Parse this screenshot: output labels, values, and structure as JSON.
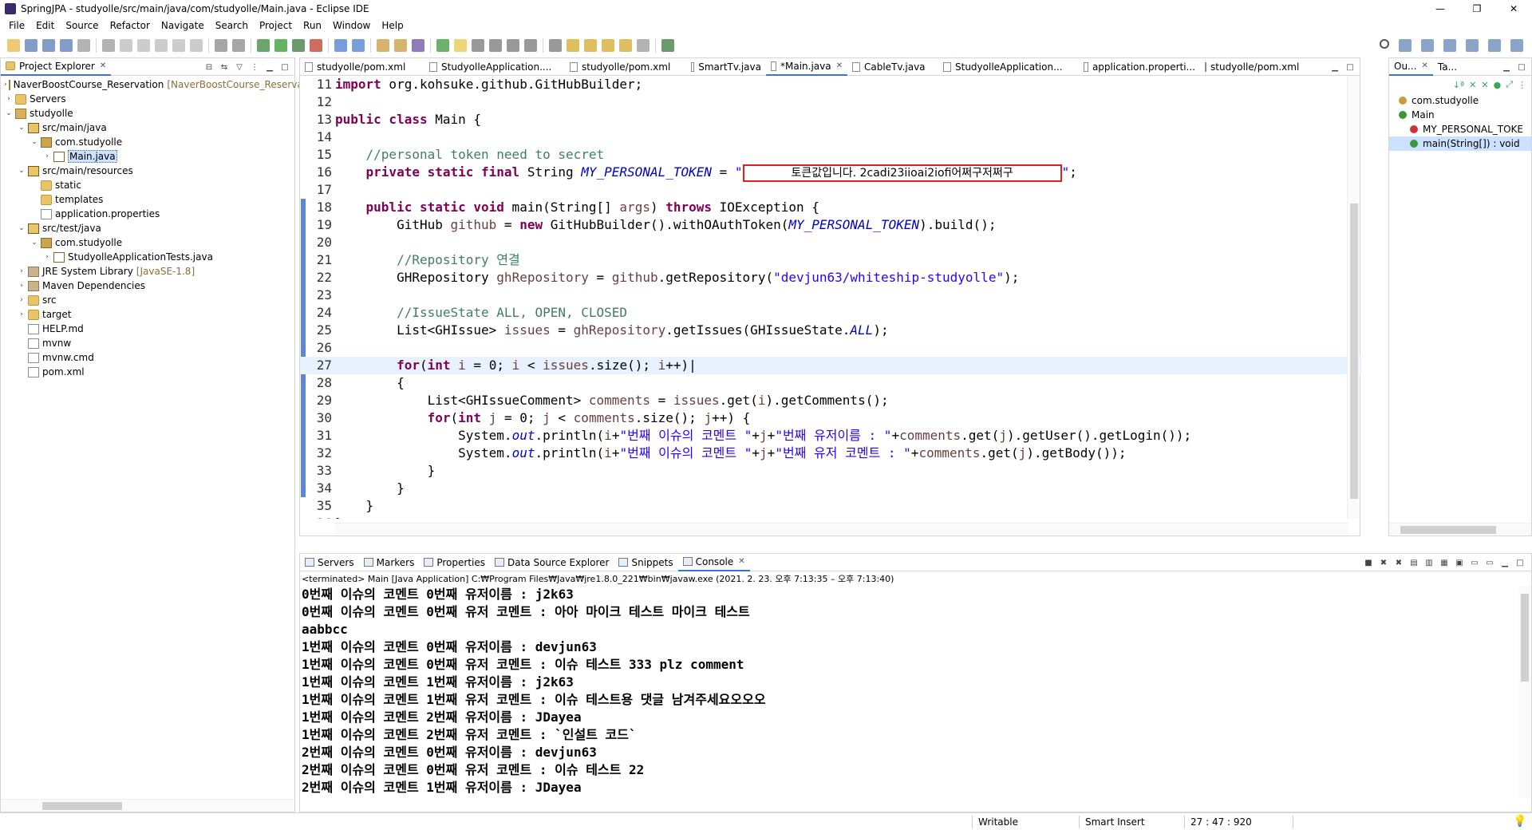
{
  "window": {
    "title": "SpringJPA - studyolle/src/main/java/com/studyolle/Main.java - Eclipse IDE"
  },
  "menu": [
    "File",
    "Edit",
    "Source",
    "Refactor",
    "Navigate",
    "Search",
    "Project",
    "Run",
    "Window",
    "Help"
  ],
  "explorer": {
    "title": "Project Explorer",
    "items": [
      {
        "label": "NaverBoostCourse_Reservation",
        "deco": "[NaverBoostCourse_Reserva",
        "depth": 0,
        "tw": ">",
        "icon": "proj"
      },
      {
        "label": "Servers",
        "depth": 0,
        "tw": ">",
        "icon": "folder"
      },
      {
        "label": "studyolle",
        "depth": 0,
        "tw": "v",
        "icon": "proj"
      },
      {
        "label": "src/main/java",
        "depth": 1,
        "tw": "v",
        "icon": "src"
      },
      {
        "label": "com.studyolle",
        "depth": 2,
        "tw": "v",
        "icon": "pkg"
      },
      {
        "label": "Main.java",
        "depth": 3,
        "tw": ">",
        "icon": "java",
        "selected": true
      },
      {
        "label": "src/main/resources",
        "depth": 1,
        "tw": "v",
        "icon": "src"
      },
      {
        "label": "static",
        "depth": 2,
        "tw": "",
        "icon": "folder"
      },
      {
        "label": "templates",
        "depth": 2,
        "tw": "",
        "icon": "folder"
      },
      {
        "label": "application.properties",
        "depth": 2,
        "tw": "",
        "icon": "file"
      },
      {
        "label": "src/test/java",
        "depth": 1,
        "tw": "v",
        "icon": "src"
      },
      {
        "label": "com.studyolle",
        "depth": 2,
        "tw": "v",
        "icon": "pkg"
      },
      {
        "label": "StudyolleApplicationTests.java",
        "depth": 3,
        "tw": ">",
        "icon": "java"
      },
      {
        "label": "JRE System Library",
        "deco": "[JavaSE-1.8]",
        "depth": 1,
        "tw": ">",
        "icon": "lib"
      },
      {
        "label": "Maven Dependencies",
        "depth": 1,
        "tw": ">",
        "icon": "lib"
      },
      {
        "label": "src",
        "depth": 1,
        "tw": ">",
        "icon": "folder"
      },
      {
        "label": "target",
        "depth": 1,
        "tw": ">",
        "icon": "folder"
      },
      {
        "label": "HELP.md",
        "depth": 1,
        "tw": "",
        "icon": "file"
      },
      {
        "label": "mvnw",
        "depth": 1,
        "tw": "",
        "icon": "file"
      },
      {
        "label": "mvnw.cmd",
        "depth": 1,
        "tw": "",
        "icon": "file"
      },
      {
        "label": "pom.xml",
        "depth": 1,
        "tw": "",
        "icon": "file"
      }
    ]
  },
  "editor": {
    "tabs": [
      {
        "label": "studyolle/pom.xml"
      },
      {
        "label": "StudyolleApplication...."
      },
      {
        "label": "studyolle/pom.xml"
      },
      {
        "label": "SmartTv.java"
      },
      {
        "label": "*Main.java",
        "active": true
      },
      {
        "label": "CableTv.java"
      },
      {
        "label": "StudyolleApplication..."
      },
      {
        "label": "application.properti..."
      },
      {
        "label": "studyolle/pom.xml"
      }
    ],
    "token_text": "토큰값입니다. 2cadi23iioai2iofi어쩌구저쩌구",
    "lines": [
      {
        "n": "11",
        "html": "<span class=\"kw\">import</span> org.kohsuke.github.GitHubBuilder;"
      },
      {
        "n": "12",
        "html": ""
      },
      {
        "n": "13",
        "html": "<span class=\"kw\">public class</span> Main {"
      },
      {
        "n": "14",
        "html": ""
      },
      {
        "n": "15",
        "html": "    <span class=\"cm\">//personal token need to secret</span>"
      },
      {
        "n": "16",
        "html": "    <span class=\"kw\">private static final</span> String <span class=\"fd\">MY_PERSONAL_TOKEN</span> = <span class=\"st\">\"</span><span id=\"tokenbox\" data-name=\"token-redaction-box\" data-interactable=\"false\" data-bind=\"editor.token_text\"></span><span class=\"st\">\"</span>;"
      },
      {
        "n": "17",
        "html": ""
      },
      {
        "n": "18",
        "html": "    <span class=\"kw\">public static void</span> main(String[] <span class=\"lv\">args</span>) <span class=\"kw\">throws</span> IOException {"
      },
      {
        "n": "19",
        "html": "        GitHub <span class=\"lv\">github</span> = <span class=\"kw\">new</span> GitHubBuilder().withOAuthToken(<span class=\"fd\">MY_PERSONAL_TOKEN</span>).build();"
      },
      {
        "n": "20",
        "html": ""
      },
      {
        "n": "21",
        "html": "        <span class=\"cm\">//Repository 연결</span>"
      },
      {
        "n": "22",
        "html": "        GHRepository <span class=\"lv\">ghRepository</span> = <span class=\"lv\">github</span>.getRepository(<span class=\"st\">\"devjun63/whiteship-studyolle\"</span>);"
      },
      {
        "n": "23",
        "html": ""
      },
      {
        "n": "24",
        "html": "        <span class=\"cm\">//IssueState ALL, OPEN, CLOSED</span>"
      },
      {
        "n": "25",
        "html": "        List&lt;GHIssue&gt; <span class=\"lv\">issues</span> = <span class=\"lv\">ghRepository</span>.getIssues(GHIssueState.<span class=\"fd\">ALL</span>);"
      },
      {
        "n": "26",
        "html": ""
      },
      {
        "n": "27",
        "html": "        <span class=\"kw\">for</span>(<span class=\"kw\">int</span> <span class=\"lv\">i</span> = 0; <span class=\"lv\">i</span> &lt; <span class=\"lv\">issues</span>.size(); <span class=\"lv\">i</span>++)|",
        "current": true
      },
      {
        "n": "28",
        "html": "        {"
      },
      {
        "n": "29",
        "html": "            List&lt;GHIssueComment&gt; <span class=\"lv\">comments</span> = <span class=\"lv\">issues</span>.get(<span class=\"lv\">i</span>).getComments();"
      },
      {
        "n": "30",
        "html": "            <span class=\"kw\">for</span>(<span class=\"kw\">int</span> <span class=\"lv\">j</span> = 0; <span class=\"lv\">j</span> &lt; <span class=\"lv\">comments</span>.size(); <span class=\"lv\">j</span>++) {"
      },
      {
        "n": "31",
        "html": "                System.<span class=\"fd\">out</span>.println(<span class=\"lv\">i</span>+<span class=\"st\">\"번째 이슈의 코멘트 \"</span>+<span class=\"lv\">j</span>+<span class=\"st\">\"번째 유저이름 : \"</span>+<span class=\"lv\">comments</span>.get(<span class=\"lv\">j</span>).getUser().getLogin());"
      },
      {
        "n": "32",
        "html": "                System.<span class=\"fd\">out</span>.println(<span class=\"lv\">i</span>+<span class=\"st\">\"번째 이슈의 코멘트 \"</span>+<span class=\"lv\">j</span>+<span class=\"st\">\"번째 유저 코멘트 : \"</span>+<span class=\"lv\">comments</span>.get(<span class=\"lv\">j</span>).getBody());"
      },
      {
        "n": "33",
        "html": "            }"
      },
      {
        "n": "34",
        "html": "        }"
      },
      {
        "n": "35",
        "html": "    }"
      },
      {
        "n": "36",
        "html": "}"
      }
    ]
  },
  "outline": {
    "tabs": [
      "Ou...",
      "Ta..."
    ],
    "items": [
      {
        "label": "com.studyolle",
        "depth": 0
      },
      {
        "label": "Main",
        "depth": 0,
        "tw": "v"
      },
      {
        "label": "MY_PERSONAL_TOKE",
        "depth": 1,
        "prefix": "SF"
      },
      {
        "label": "main(String[]) : void",
        "depth": 1,
        "prefix": "S",
        "selected": true
      }
    ]
  },
  "bottom": {
    "tabs": [
      {
        "label": "Servers"
      },
      {
        "label": "Markers"
      },
      {
        "label": "Properties"
      },
      {
        "label": "Data Source Explorer"
      },
      {
        "label": "Snippets"
      },
      {
        "label": "Console",
        "active": true
      }
    ],
    "status": "<terminated> Main [Java Application] C:₩Program Files₩Java₩jre1.8.0_221₩bin₩javaw.exe  (2021. 2. 23. 오후 7:13:35 – 오후 7:13:40)",
    "lines": [
      "0번째 이슈의 코멘트 0번째 유저이름 : j2k63",
      "0번째 이슈의 코멘트 0번째 유저 코멘트 : 아아 마이크 테스트 마이크 테스트",
      "aabbcc",
      "1번째 이슈의 코멘트 0번째 유저이름 : devjun63",
      "1번째 이슈의 코멘트 0번째 유저 코멘트 : 이슈 테스트 333 plz comment",
      "1번째 이슈의 코멘트 1번째 유저이름 : j2k63",
      "1번째 이슈의 코멘트 1번째 유저 코멘트 : 이슈 테스트용 댓글 남겨주세요오오오",
      "1번째 이슈의 코멘트 2번째 유저이름 : JDayea",
      "1번째 이슈의 코멘트 2번째 유저 코멘트 : `인설트 코드`",
      "2번째 이슈의 코멘트 0번째 유저이름 : devjun63",
      "2번째 이슈의 코멘트 0번째 유저 코멘트 : 이슈 테스트 22",
      "2번째 이슈의 코멘트 1번째 유저이름 : JDayea"
    ]
  },
  "statusbar": {
    "mode": "Writable",
    "insert": "Smart Insert",
    "position": "27 : 47 : 920"
  }
}
